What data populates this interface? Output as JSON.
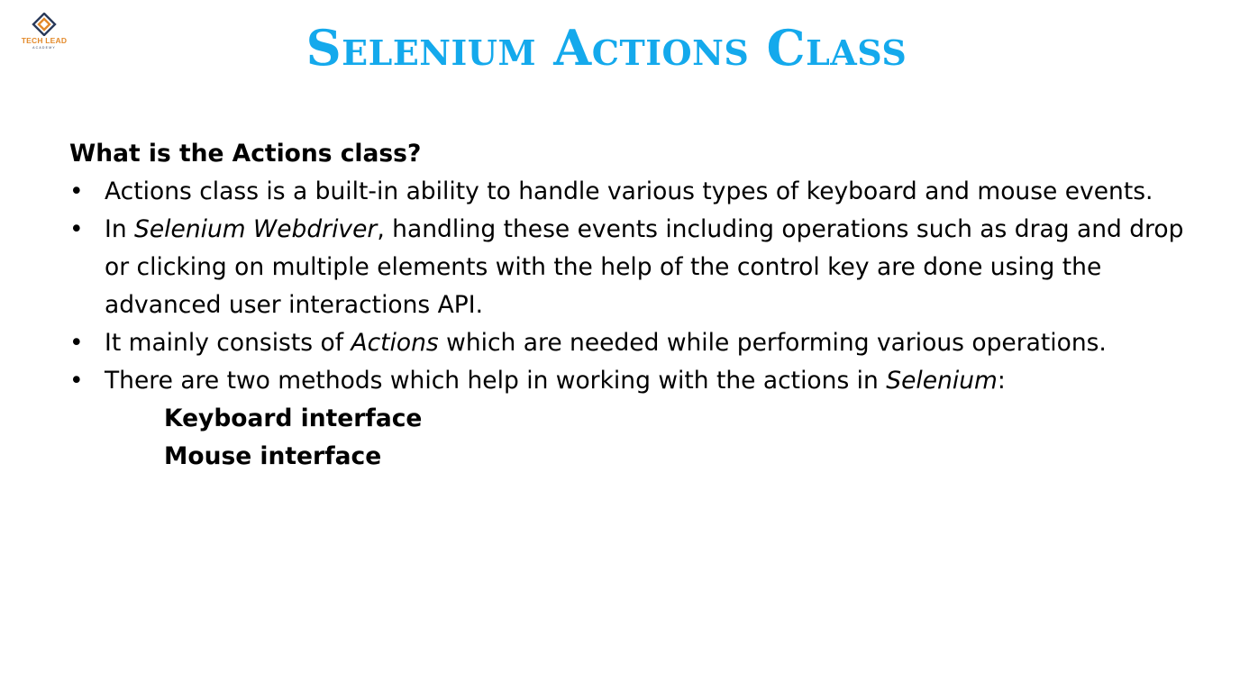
{
  "logo": {
    "name": "TECH LEAD",
    "subtitle": "ACADEMY"
  },
  "slide": {
    "title": "Selenium Actions Class",
    "question": "What is the Actions class?",
    "bullets": [
      {
        "parts": [
          "Actions class is a built-in ability to handle various types of keyboard and mouse events."
        ]
      },
      {
        "parts": [
          "In ",
          "Selenium Webdriver",
          ", handling these events including operations such as drag and drop or clicking on multiple elements with the help of the control key are done using the advanced user interactions API."
        ]
      },
      {
        "parts": [
          "It mainly consists of ",
          "Actions",
          " which are needed while performing various operations."
        ]
      },
      {
        "parts": [
          "There are two methods which help in working with the actions in ",
          "Selenium",
          ":"
        ]
      }
    ],
    "interfaces": [
      "Keyboard interface",
      "Mouse interface"
    ]
  },
  "colors": {
    "title": "#14a9ec",
    "logo_accent": "#e38a2b",
    "logo_dark": "#2a3a5a"
  },
  "icons": {
    "logo_mark": "diamond-logo-icon",
    "bullet": "bullet-dot"
  }
}
